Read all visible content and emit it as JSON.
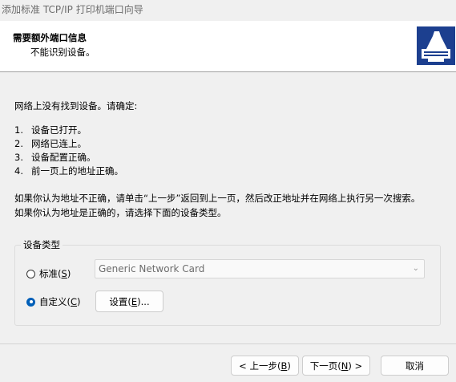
{
  "window": {
    "title": "添加标准 TCP/IP 打印机端口向导"
  },
  "header": {
    "title": "需要额外端口信息",
    "subtitle": "不能识别设备。"
  },
  "body": {
    "intro": "网络上没有找到设备。请确定:",
    "checklist": [
      {
        "num": "1.",
        "text": "设备已打开。"
      },
      {
        "num": "2.",
        "text": "网络已连上。"
      },
      {
        "num": "3.",
        "text": "设备配置正确。"
      },
      {
        "num": "4.",
        "text": "前一页上的地址正确。"
      }
    ],
    "note1": "如果你认为地址不正确，请单击“上一步”返回到上一页，然后改正地址并在网络上执行另一次搜索。",
    "note2": "如果你认为地址是正确的，请选择下面的设备类型。"
  },
  "device_type": {
    "group_label": "设备类型",
    "standard": {
      "label": "标准(",
      "key": "S",
      "suffix": ")",
      "checked": false
    },
    "standard_value": "Generic Network Card",
    "custom": {
      "label": "自定义(",
      "key": "C",
      "suffix": ")",
      "checked": true
    },
    "settings": {
      "label": "设置(",
      "key": "E",
      "suffix": ")..."
    }
  },
  "footer": {
    "back": {
      "prefix": "< 上一步(",
      "key": "B",
      "suffix": ")"
    },
    "next": {
      "prefix": "下一页(",
      "key": "N",
      "suffix": ") >"
    },
    "cancel": "取消"
  },
  "colors": {
    "accent": "#005fb8",
    "icon_bg": "#1c3f8f"
  }
}
